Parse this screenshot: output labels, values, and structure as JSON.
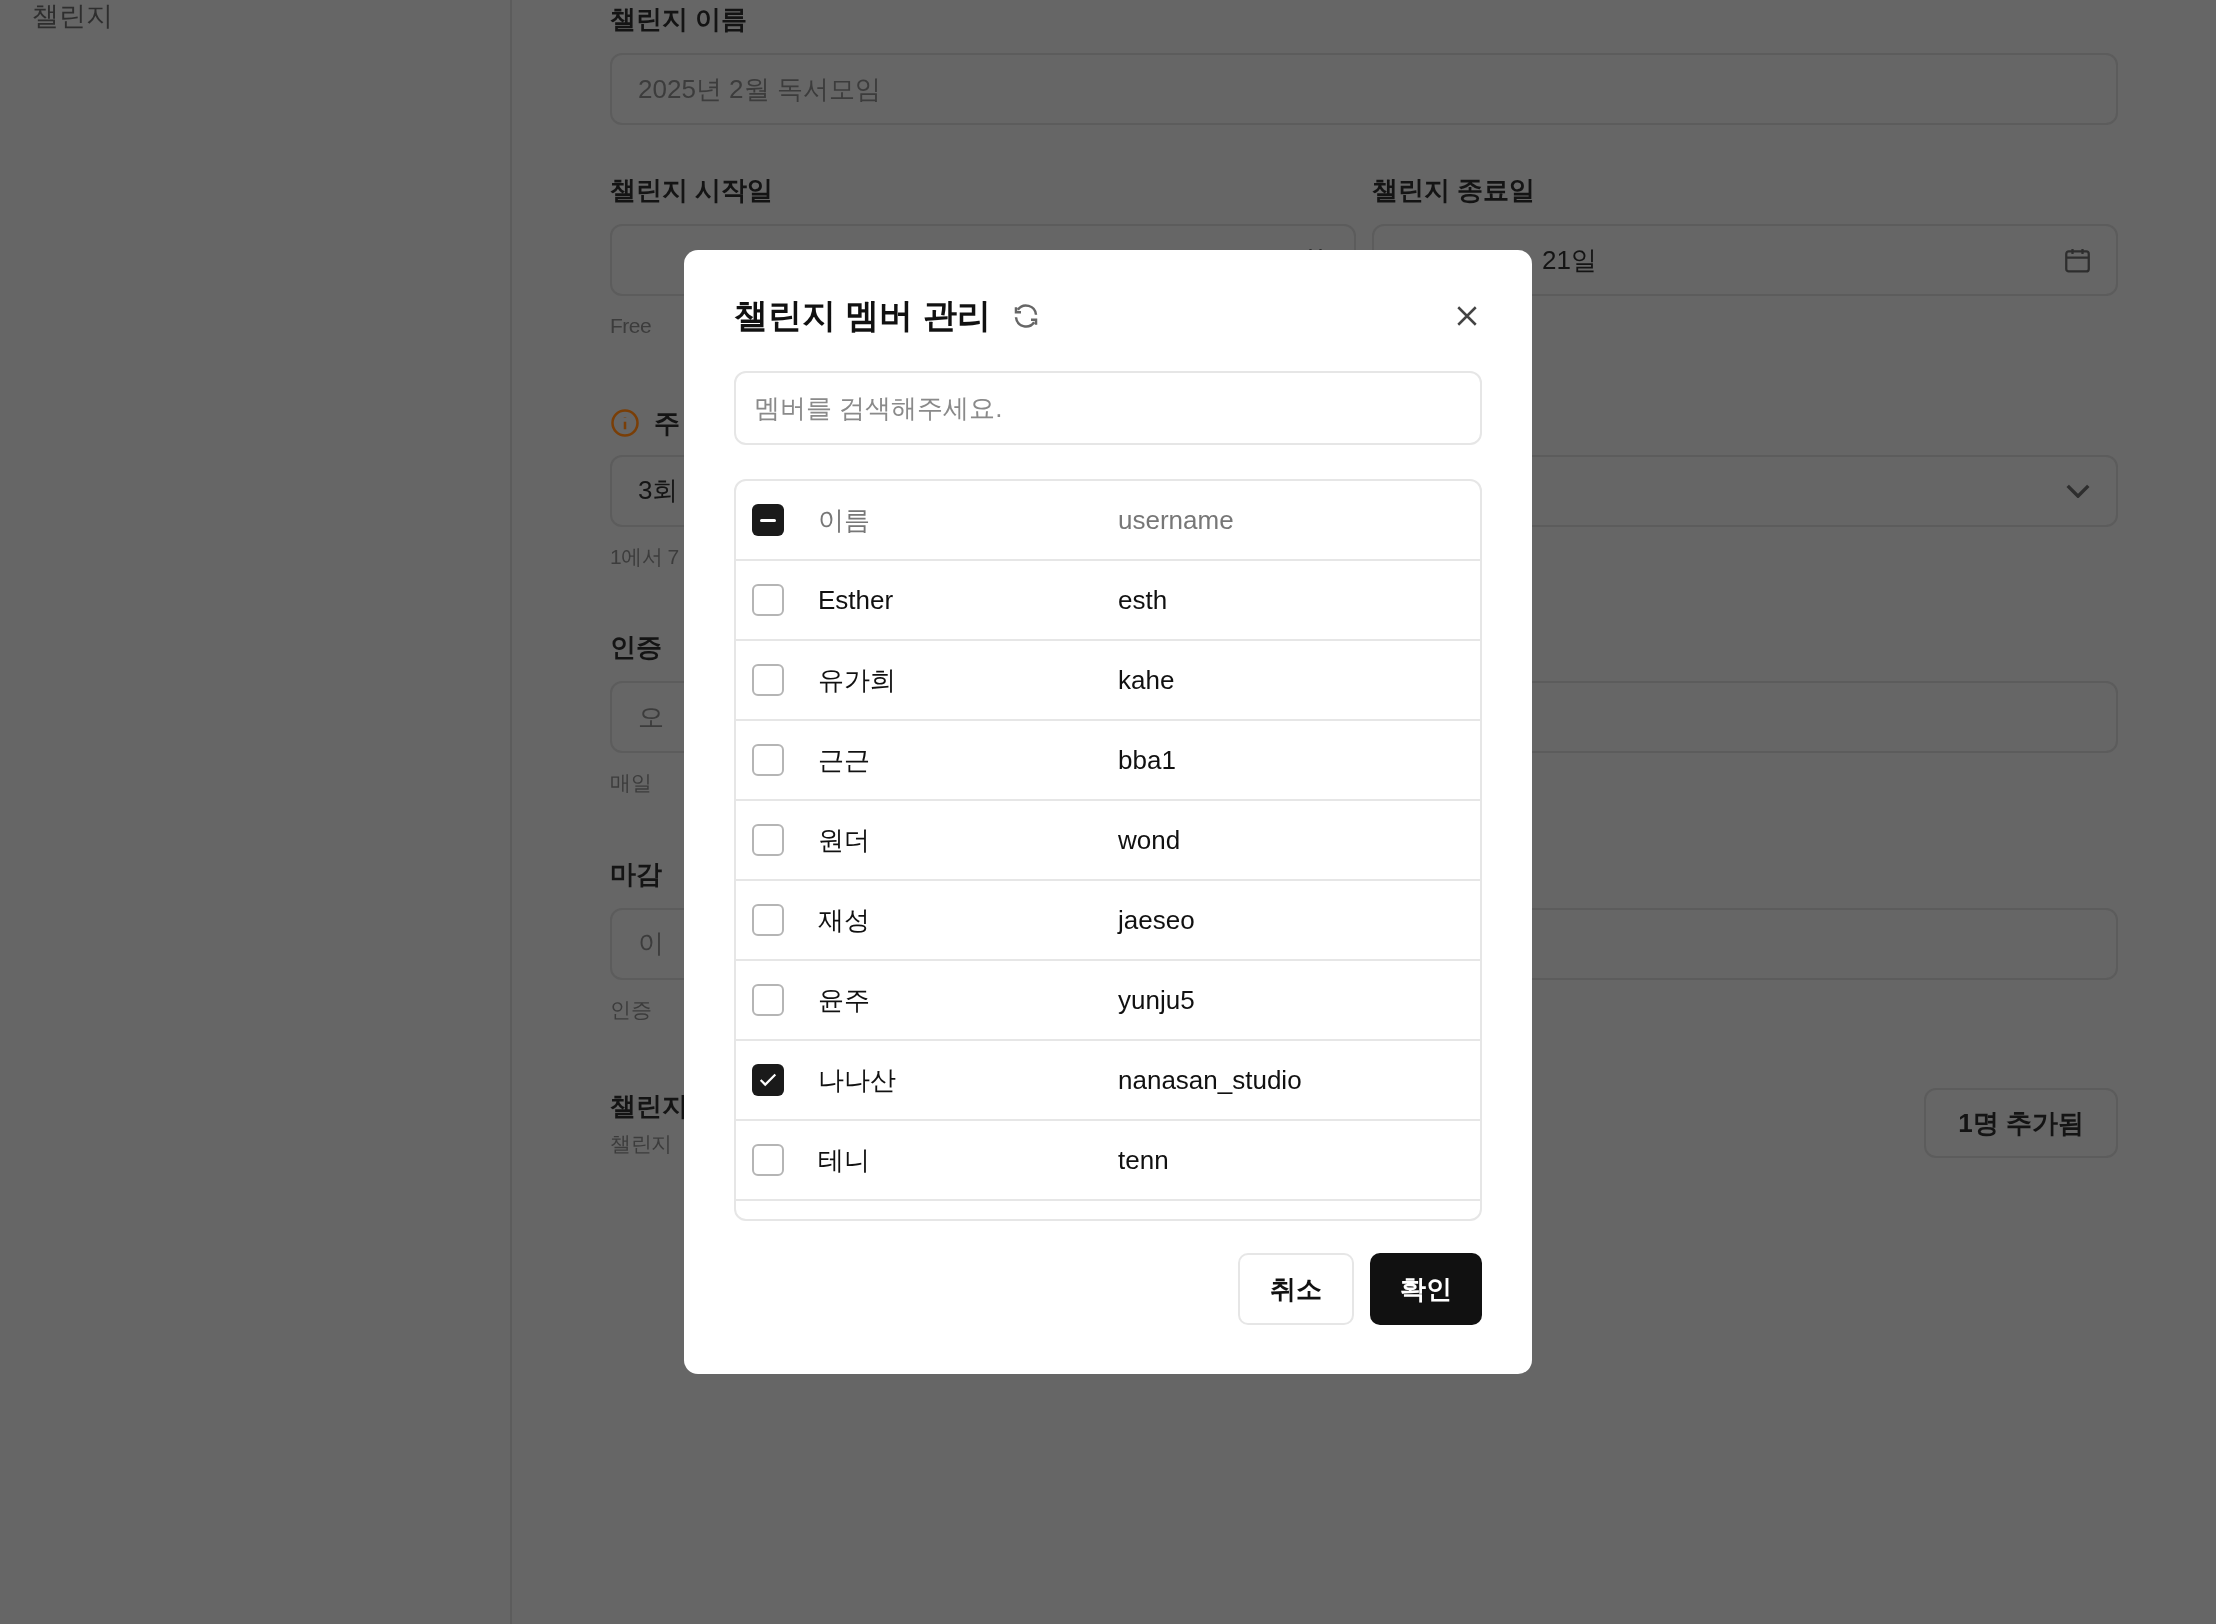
{
  "sidebar": {
    "items": [
      {
        "label": "챌린지"
      }
    ]
  },
  "form": {
    "name_label": "챌린지 이름",
    "name_placeholder": "2025년 2월 독서모임",
    "start_label": "챌린지 시작일",
    "end_label": "챌린지 종료일",
    "end_value": "21일",
    "start_help": "Free",
    "frequency_label": "주",
    "frequency_value": "3회",
    "frequency_help": "1에서 7",
    "verify_label": "인증",
    "verify_placeholder": "오",
    "verify_help": "매일",
    "deadline_label": "마감",
    "deadline_placeholder": "이",
    "deadline_help": "인증",
    "members_label": "챌린지",
    "members_help": "챌린지",
    "members_button": "1명 추가됨"
  },
  "dialog": {
    "title": "챌린지 멤버 관리",
    "search_placeholder": "멤버를 검색해주세요.",
    "header": {
      "indeterminate": true,
      "columns": [
        "이름",
        "username"
      ]
    },
    "rows": [
      {
        "name": "Esther",
        "username": "esth",
        "checked": false
      },
      {
        "name": "유가희",
        "username": "kahe",
        "checked": false
      },
      {
        "name": "근근",
        "username": "bba1",
        "checked": false
      },
      {
        "name": "원더",
        "username": "wond",
        "checked": false
      },
      {
        "name": "재성",
        "username": "jaeseo",
        "checked": false
      },
      {
        "name": "윤주",
        "username": "yunju5",
        "checked": false
      },
      {
        "name": "나나산",
        "username": "nanasan_studio",
        "checked": true
      },
      {
        "name": "테니",
        "username": "tenn",
        "checked": false
      }
    ],
    "buttons": {
      "cancel": "취소",
      "confirm": "확인"
    }
  }
}
